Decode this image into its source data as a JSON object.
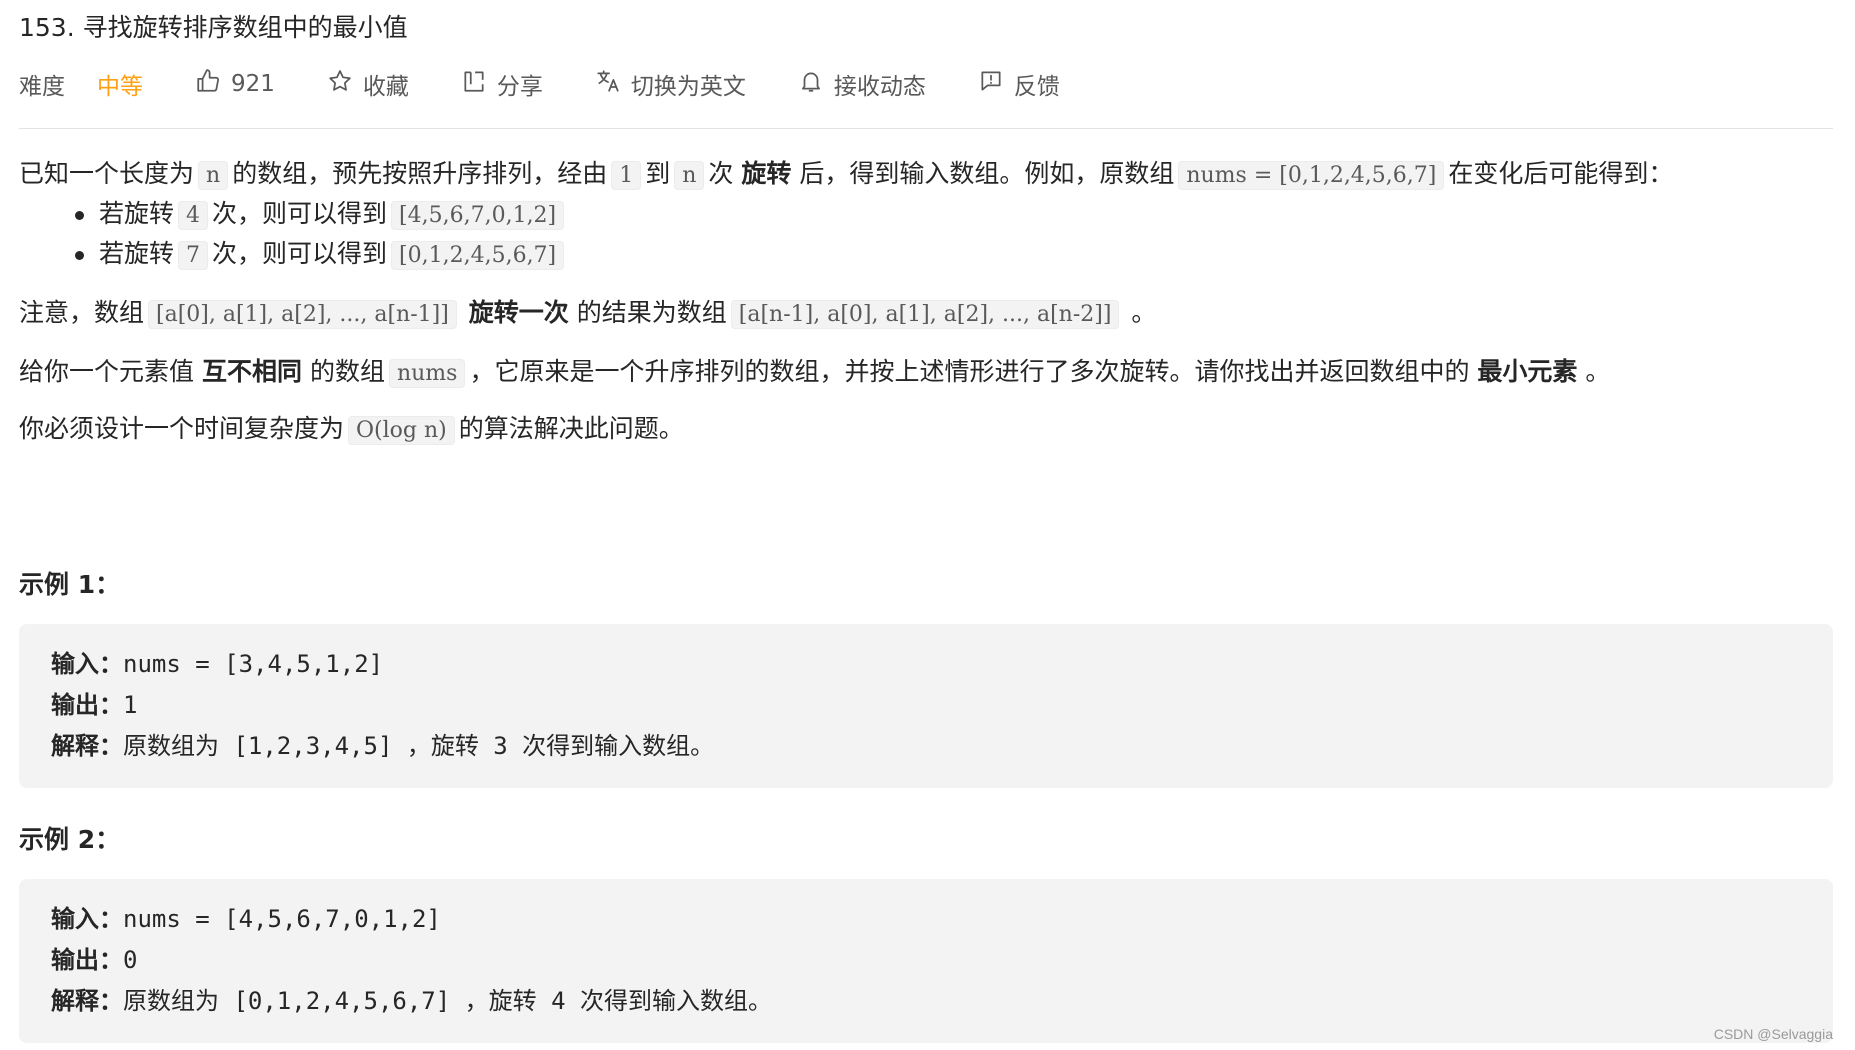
{
  "problem": {
    "title": "153. 寻找旋转排序数组中的最小值"
  },
  "toolbar": {
    "difficulty_label": "难度",
    "difficulty_value": "中等",
    "like_count": "921",
    "collect_label": "收藏",
    "share_label": "分享",
    "translate_label": "切换为英文",
    "subscribe_label": "接收动态",
    "feedback_label": "反馈",
    "colors": {
      "difficulty_medium": "#ffa116"
    }
  },
  "description": {
    "p1": {
      "t1": "已知一个长度为",
      "c1": "n",
      "t2": "的数组，预先按照升序排列，经由",
      "c2": "1",
      "t3": "到",
      "c3": "n",
      "t4": "次",
      "b1": "旋转",
      "t5": "后，得到输入数组。例如，原数组",
      "c4": "nums = [0,1,2,4,5,6,7]",
      "t6": "在变化后可能得到："
    },
    "bullets": [
      {
        "pre": "若旋转",
        "n": "4",
        "mid": "次，则可以得到",
        "arr": "[4,5,6,7,0,1,2]"
      },
      {
        "pre": "若旋转",
        "n": "7",
        "mid": "次，则可以得到",
        "arr": "[0,1,2,4,5,6,7]"
      }
    ],
    "p2": {
      "t1": "注意，数组",
      "c1": "[a[0], a[1], a[2], ..., a[n-1]]",
      "b1": "旋转一次",
      "t2": "的结果为数组",
      "c2": "[a[n-1], a[0], a[1], a[2], ..., a[n-2]]",
      "t3": "。"
    },
    "p3": {
      "t1": "给你一个元素值",
      "b1": "互不相同",
      "t2": "的数组",
      "c1": "nums",
      "t3": "，它原来是一个升序排列的数组，并按上述情形进行了多次旋转。请你找出并返回数组中的",
      "b2": "最小元素",
      "t4": "。"
    },
    "p4": {
      "t1": "你必须设计一个时间复杂度为",
      "c1": "O(log n)",
      "t2": "的算法解决此问题。"
    }
  },
  "examples": [
    {
      "title": "示例 1：",
      "input_label": "输入：",
      "input": "nums = [3,4,5,1,2]",
      "output_label": "输出：",
      "output": "1",
      "explain_label": "解释：",
      "explain": "原数组为 [1,2,3,4,5] ，旋转 3 次得到输入数组。"
    },
    {
      "title": "示例 2：",
      "input_label": "输入：",
      "input": "nums = [4,5,6,7,0,1,2]",
      "output_label": "输出：",
      "output": "0",
      "explain_label": "解释：",
      "explain": "原数组为 [0,1,2,4,5,6,7] ，旋转 4 次得到输入数组。"
    }
  ],
  "watermark": "CSDN @Selvaggia"
}
